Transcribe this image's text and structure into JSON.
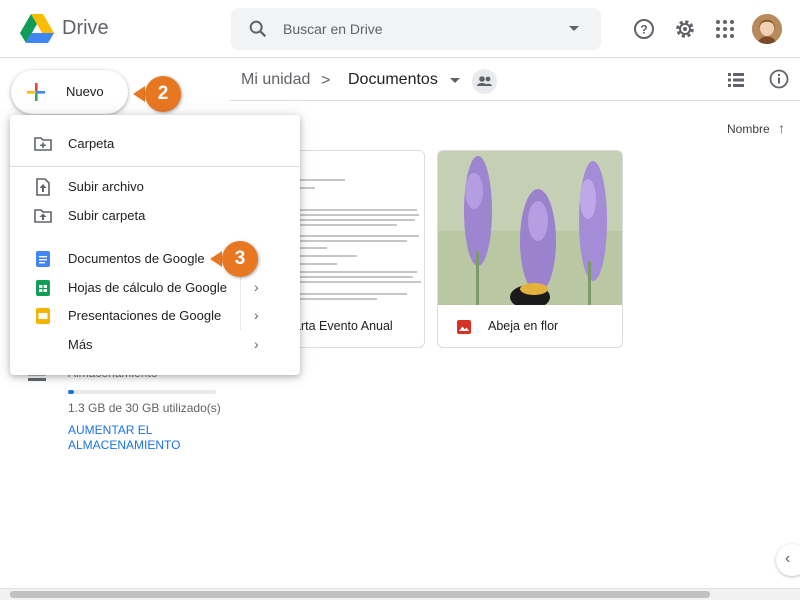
{
  "app": {
    "name": "Drive"
  },
  "search": {
    "placeholder": "Buscar en Drive"
  },
  "header_icons": [
    "help-icon",
    "settings-icon",
    "apps-icon"
  ],
  "new_button": {
    "label": "Nuevo"
  },
  "steps": {
    "step_a": "2",
    "step_b": "3"
  },
  "breadcrumb": {
    "root": "Mi unidad",
    "separator": ">",
    "current": "Documentos"
  },
  "sort": {
    "label": "Nombre",
    "arrow": "↑"
  },
  "menu": {
    "items": [
      {
        "label": "Carpeta",
        "icon": "new-folder-icon"
      },
      {
        "label": "Subir archivo",
        "icon": "upload-file-icon"
      },
      {
        "label": "Subir carpeta",
        "icon": "upload-folder-icon"
      },
      {
        "label": "Documentos de Google",
        "icon": "google-docs-icon"
      },
      {
        "label": "Hojas de cálculo de Google",
        "icon": "google-sheets-icon"
      },
      {
        "label": "Presentaciones de Google",
        "icon": "google-slides-icon"
      },
      {
        "label": "Más",
        "icon": ""
      }
    ],
    "submenu_arrow": "›"
  },
  "files": [
    {
      "name": "Carta Evento Anual",
      "type": "document"
    },
    {
      "name": "Abeja en flor",
      "type": "image"
    }
  ],
  "storage": {
    "label": "Almacenamiento",
    "used_text": "1.3 GB de 30 GB utilizado(s)",
    "used_fraction": 0.043,
    "upgrade_link": "AUMENTAR EL ALMACENAMIENTO"
  },
  "colors": {
    "accent": "#1a73e8",
    "marker": "#e87722",
    "docs": "#4285f4",
    "sheets": "#0f9d58",
    "slides": "#f4b400",
    "image_icon": "#d93025"
  }
}
